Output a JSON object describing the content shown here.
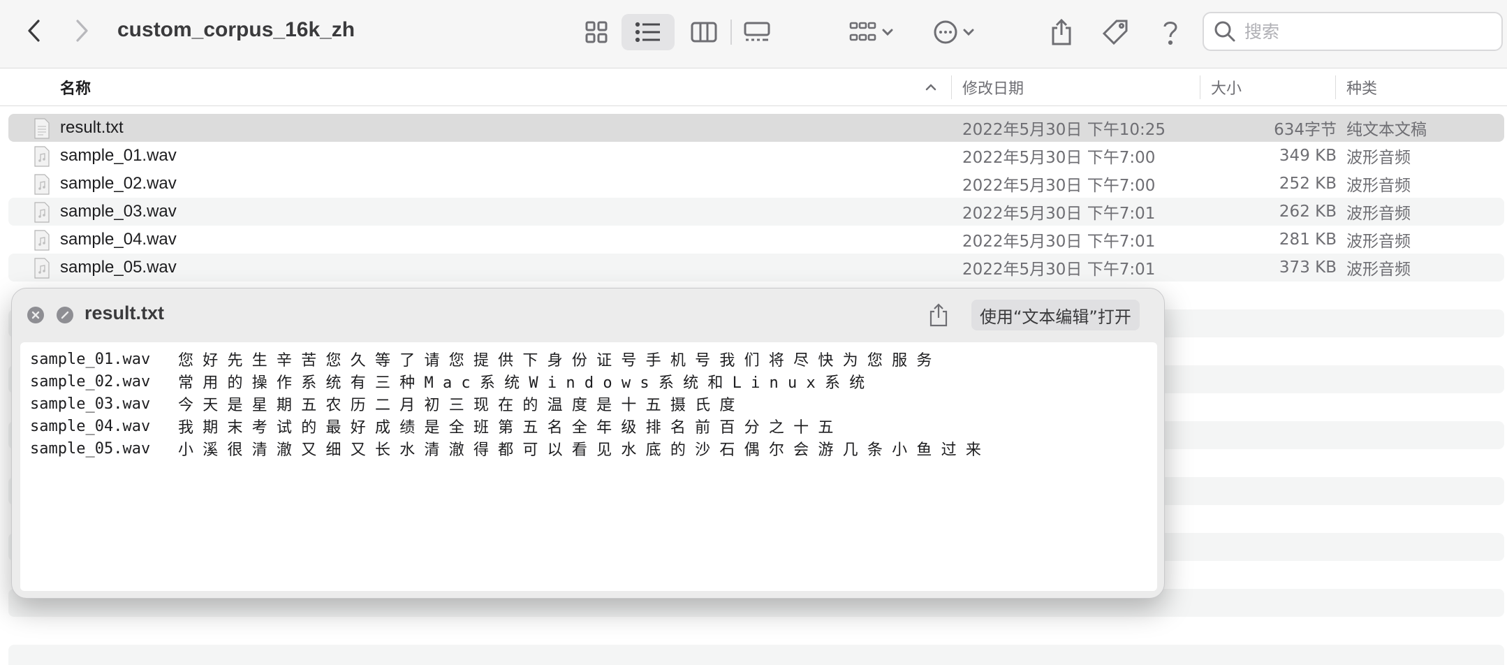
{
  "toolbar": {
    "title": "custom_corpus_16k_zh",
    "search_placeholder": "搜索",
    "search_value": ""
  },
  "columns": {
    "name": "名称",
    "modified": "修改日期",
    "size": "大小",
    "kind": "种类"
  },
  "files": [
    {
      "name": "result.txt",
      "modified": "2022年5月30日 下午10:25",
      "size": "634字节",
      "kind": "纯文本文稿",
      "icon": "text-document-icon"
    },
    {
      "name": "sample_01.wav",
      "modified": "2022年5月30日 下午7:00",
      "size": "349 KB",
      "kind": "波形音频",
      "icon": "audio-file-icon"
    },
    {
      "name": "sample_02.wav",
      "modified": "2022年5月30日 下午7:00",
      "size": "252 KB",
      "kind": "波形音频",
      "icon": "audio-file-icon"
    },
    {
      "name": "sample_03.wav",
      "modified": "2022年5月30日 下午7:01",
      "size": "262 KB",
      "kind": "波形音频",
      "icon": "audio-file-icon"
    },
    {
      "name": "sample_04.wav",
      "modified": "2022年5月30日 下午7:01",
      "size": "281 KB",
      "kind": "波形音频",
      "icon": "audio-file-icon"
    },
    {
      "name": "sample_05.wav",
      "modified": "2022年5月30日 下午7:01",
      "size": "373 KB",
      "kind": "波形音频",
      "icon": "audio-file-icon"
    }
  ],
  "quicklook": {
    "title": "result.txt",
    "open_label": "使用“文本编辑”打开",
    "lines": [
      {
        "file": "sample_01.wav",
        "text": "您 好 先 生 辛 苦 您 久 等 了 请 您 提 供 下 身 份 证 号 手 机 号 我 们 将 尽 快 为 您 服 务"
      },
      {
        "file": "sample_02.wav",
        "text": "常 用 的 操 作 系 统 有 三 种 M a c 系 统 W i n d o w s 系 统 和 L i n u x 系 统"
      },
      {
        "file": "sample_03.wav",
        "text": "今 天 是 星 期 五 农 历 二 月 初 三 现 在 的 温 度 是 十 五 摄 氏 度"
      },
      {
        "file": "sample_04.wav",
        "text": "我 期 末 考 试 的 最 好 成 绩 是 全 班 第 五 名 全 年 级 排 名 前 百 分 之 十 五"
      },
      {
        "file": "sample_05.wav",
        "text": "小 溪 很 清 澈 又 细 又 长 水 清 澈 得 都 可 以 看 见 水 底 的 沙 石 偶 尔 会 游 几 条 小 鱼 过 来"
      }
    ]
  }
}
